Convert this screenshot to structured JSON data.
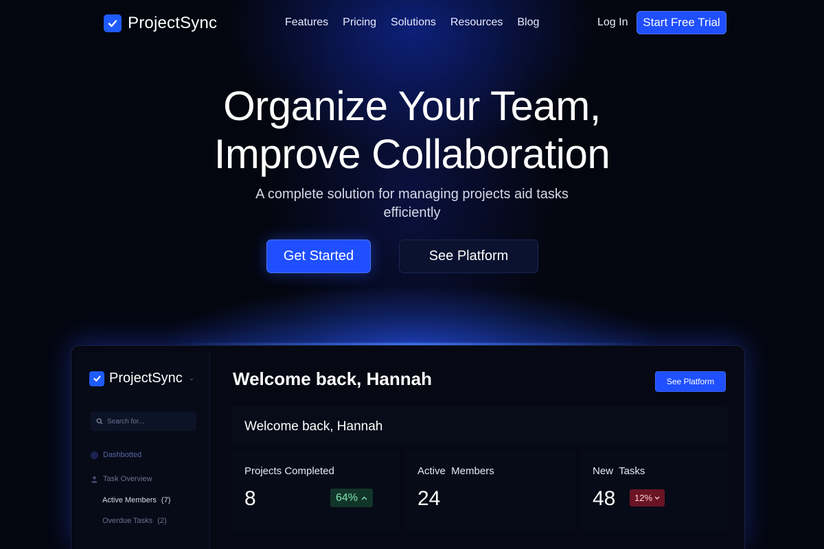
{
  "nav": {
    "brand": "ProjectSync",
    "links": [
      "Features",
      "Pricing",
      "Solutions",
      "Resources",
      "Blog"
    ],
    "login": "Log In",
    "trial": "Start Free Trial"
  },
  "hero": {
    "title_line1": "Organize Your Team,",
    "title_line2": "Improve Collaboration",
    "subtitle": "A complete solution for managing projects aid tasks efficiently",
    "primary_cta": "Get Started",
    "secondary_cta": "See Platform"
  },
  "dashboard": {
    "brand": "ProjectSync",
    "search": {
      "placeholder": "Search for..."
    },
    "sidebar": {
      "dashboard": "Dashbotted",
      "task_overview": "Task Overview",
      "active_members": {
        "label": "Active Members",
        "count": "(7)"
      },
      "overdue_tasks": {
        "label": "Overdue Tasks",
        "count": "(2)"
      }
    },
    "title": "Welcome back, Hannah",
    "see_platform": "See Platform",
    "welcome_card": "Welcome back, Hannah",
    "stats": [
      {
        "label": "Projects Completed",
        "value": "8",
        "badge": "64%",
        "trend": "up"
      },
      {
        "label": "Active  Members",
        "value": "24"
      },
      {
        "label": "New  Tasks",
        "value": "48",
        "badge": "12%",
        "trend": "down"
      }
    ]
  },
  "colors": {
    "accent": "#1f4fff",
    "background": "#04060f",
    "badge_up_bg": "#12352a",
    "badge_up_text": "#7fe3b3",
    "badge_down_bg": "#6a1424"
  },
  "icons": {
    "logo": "check-icon",
    "search": "search-icon",
    "up": "chevron-up-icon",
    "down": "chevron-down-icon"
  }
}
